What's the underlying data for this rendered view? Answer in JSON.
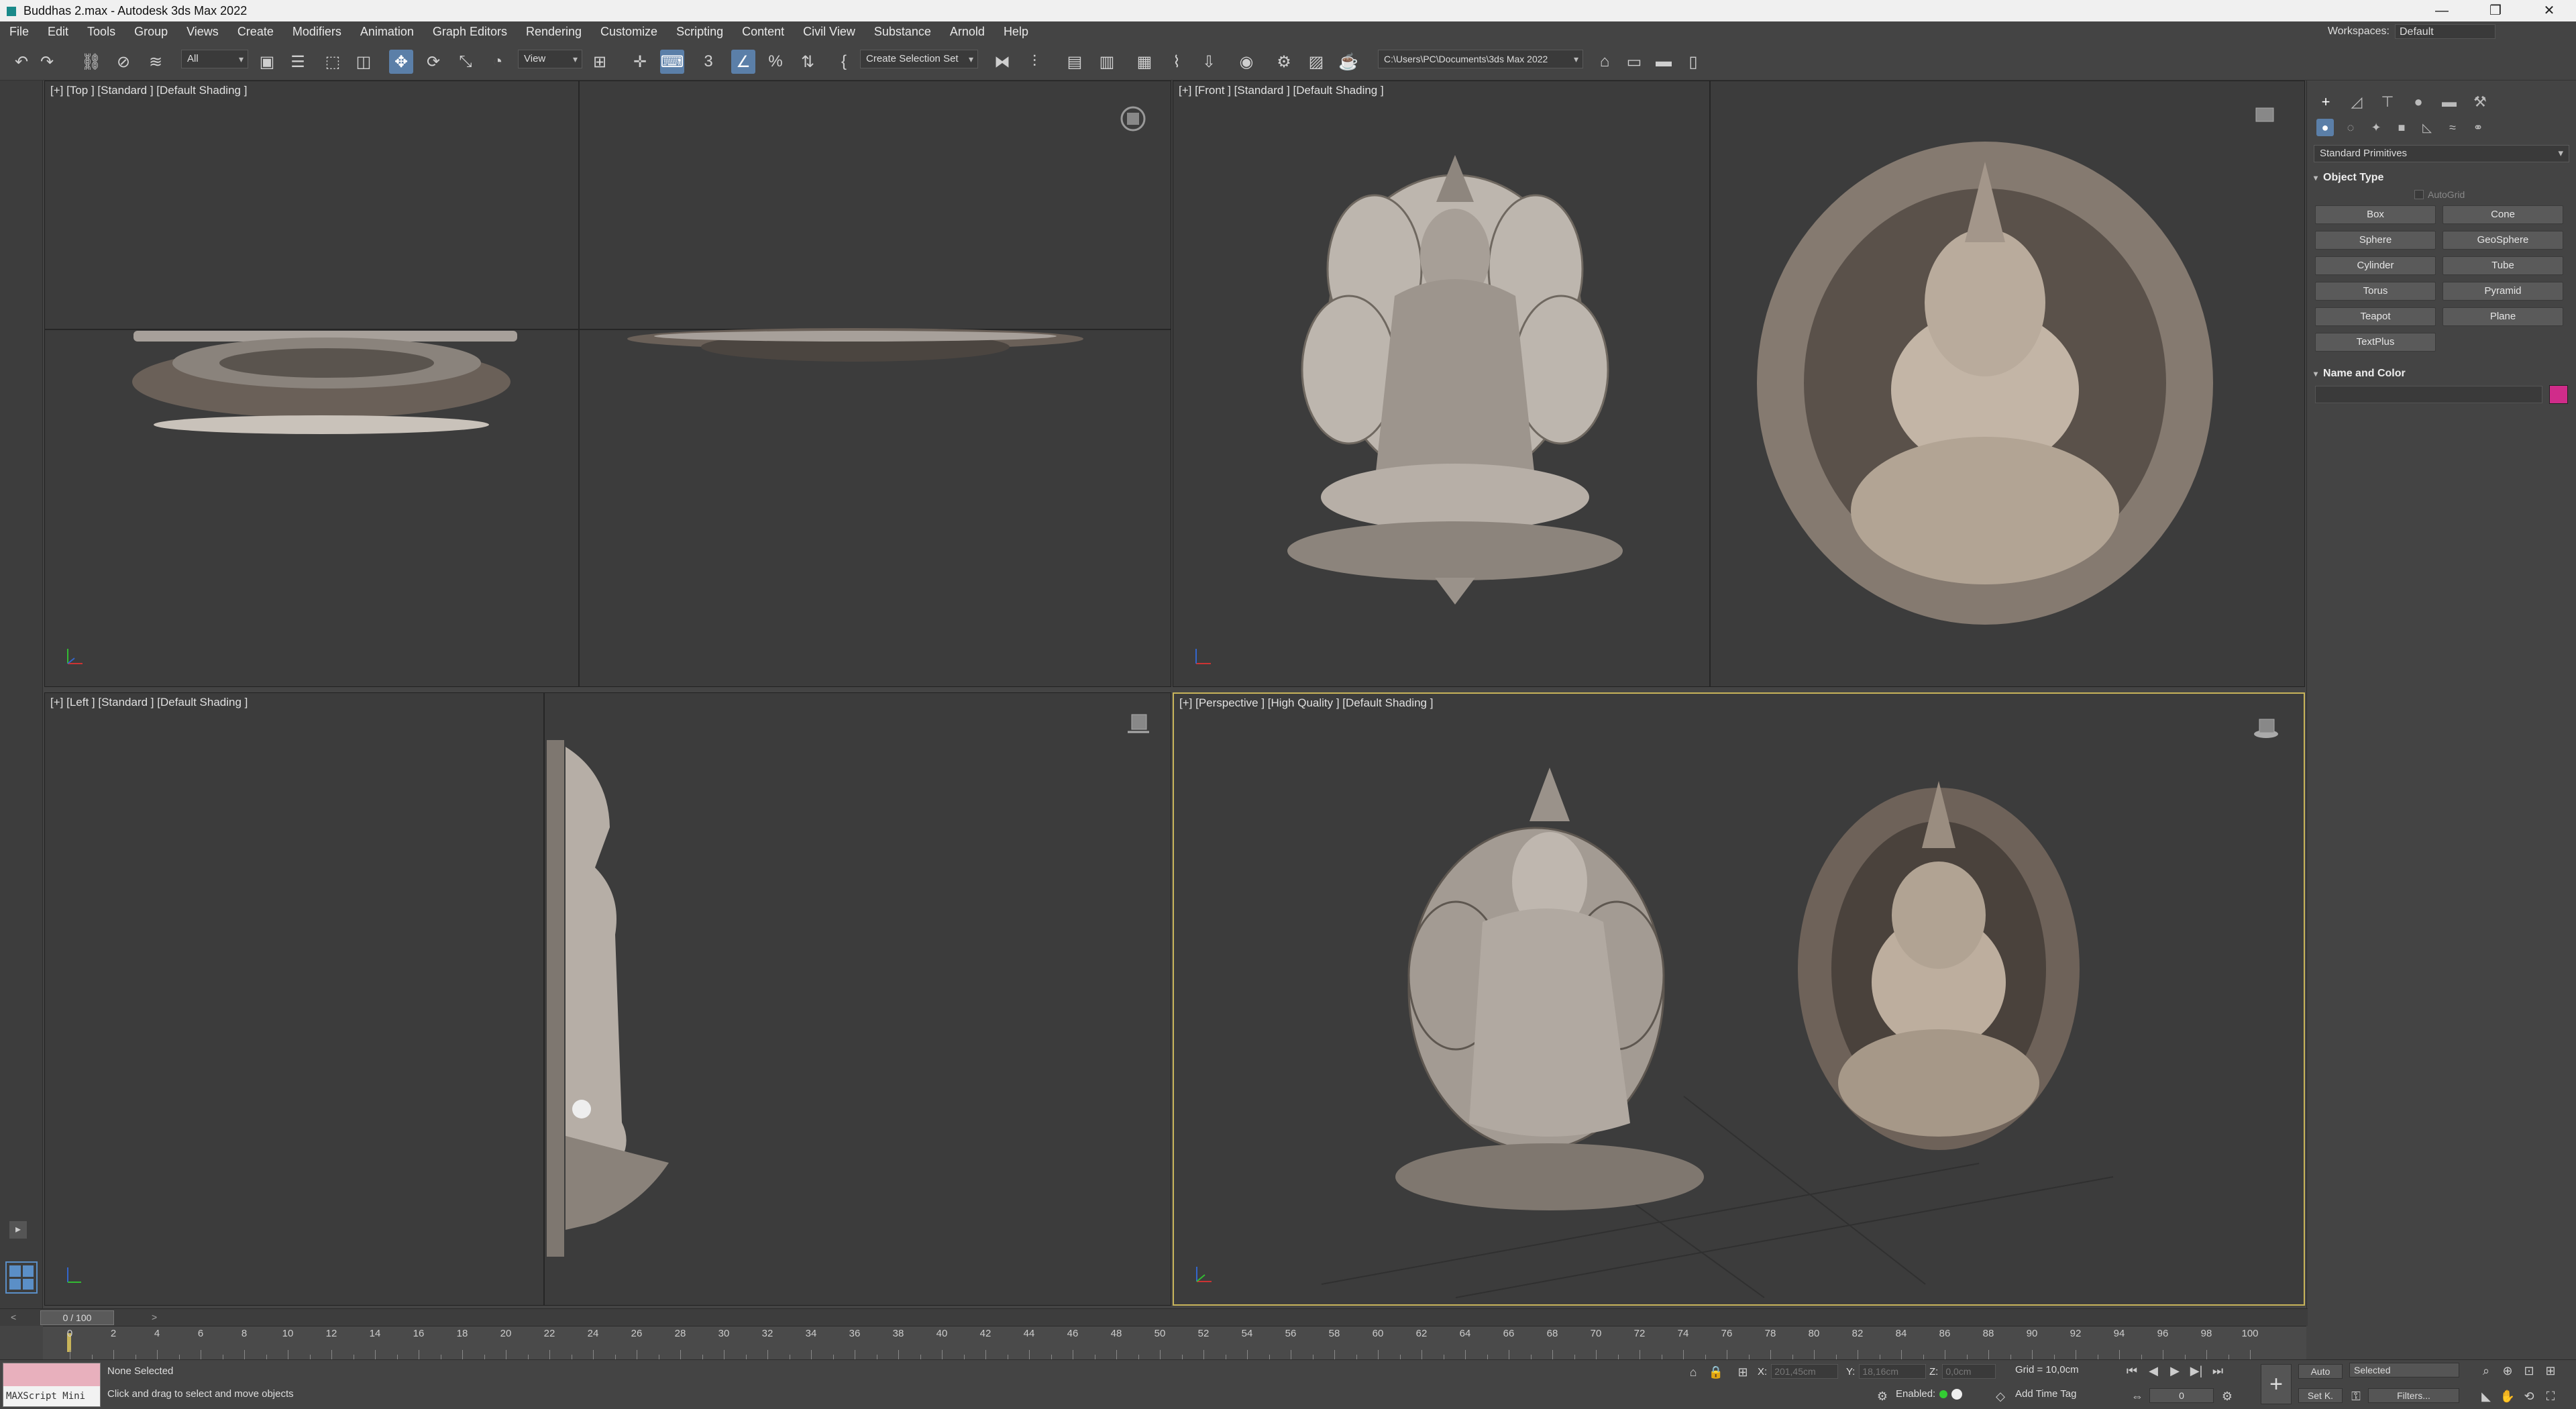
{
  "window": {
    "title": "Buddhas 2.max - Autodesk 3ds Max 2022",
    "controls": [
      "—",
      "❐",
      "✕"
    ]
  },
  "menu": {
    "items": [
      "File",
      "Edit",
      "Tools",
      "Group",
      "Views",
      "Create",
      "Modifiers",
      "Animation",
      "Graph Editors",
      "Rendering",
      "Customize",
      "Scripting",
      "Content",
      "Civil View",
      "Substance",
      "Arnold",
      "Help"
    ],
    "workspaces_label": "Workspaces:",
    "workspace_value": "Default"
  },
  "toolbar": {
    "selection_filter": "All",
    "ref_coord": "View",
    "selection_set": "Create Selection Set",
    "project_path": "C:\\Users\\PC\\Documents\\3ds Max 2022"
  },
  "viewports": {
    "top": {
      "label": "[+] [Top ] [Standard ] [Default Shading ]"
    },
    "front": {
      "label": "[+] [Front ] [Standard ] [Default Shading ]"
    },
    "left": {
      "label": "[+] [Left ] [Standard ] [Default Shading ]"
    },
    "perspective": {
      "label": "[+] [Perspective ] [High Quality ] [Default Shading ]"
    }
  },
  "command_panel": {
    "category_dropdown": "Standard Primitives",
    "object_type_title": "Object Type",
    "autogrid_label": "AutoGrid",
    "primitives": [
      "Box",
      "Cone",
      "Sphere",
      "GeoSphere",
      "Cylinder",
      "Tube",
      "Torus",
      "Pyramid",
      "Teapot",
      "Plane",
      "TextPlus"
    ],
    "name_color_title": "Name and Color",
    "object_color": "#d02c8a"
  },
  "timeline": {
    "frame_display": "0 / 100",
    "ticks": [
      "0",
      "2",
      "4",
      "6",
      "8",
      "10",
      "12",
      "14",
      "16",
      "18",
      "20",
      "22",
      "24",
      "26",
      "28",
      "30",
      "32",
      "34",
      "36",
      "38",
      "40",
      "42",
      "44",
      "46",
      "48",
      "50",
      "52",
      "54",
      "56",
      "58",
      "60",
      "62",
      "64",
      "66",
      "68",
      "70",
      "72",
      "74",
      "76",
      "78",
      "80",
      "82",
      "84",
      "86",
      "88",
      "90",
      "92",
      "94",
      "96",
      "98",
      "100"
    ]
  },
  "status": {
    "maxscript_label": "MAXScript Mini",
    "selection": "None Selected",
    "prompt": "Click and drag to select and move objects",
    "x_label": "X:",
    "x_value": "201,45cm",
    "y_label": "Y:",
    "y_value": "18,16cm",
    "z_label": "Z:",
    "z_value": "0,0cm",
    "grid": "Grid = 10,0cm",
    "enabled_label": "Enabled:",
    "add_time_tag": "Add Time Tag",
    "auto_key": "Auto",
    "set_key": "Set K.",
    "key_filter_select": "Selected",
    "filters": "Filters...",
    "frame_field": "0"
  },
  "colors": {
    "accent": "#5b7fa8",
    "active_viewport_border": "#c8b45a"
  }
}
